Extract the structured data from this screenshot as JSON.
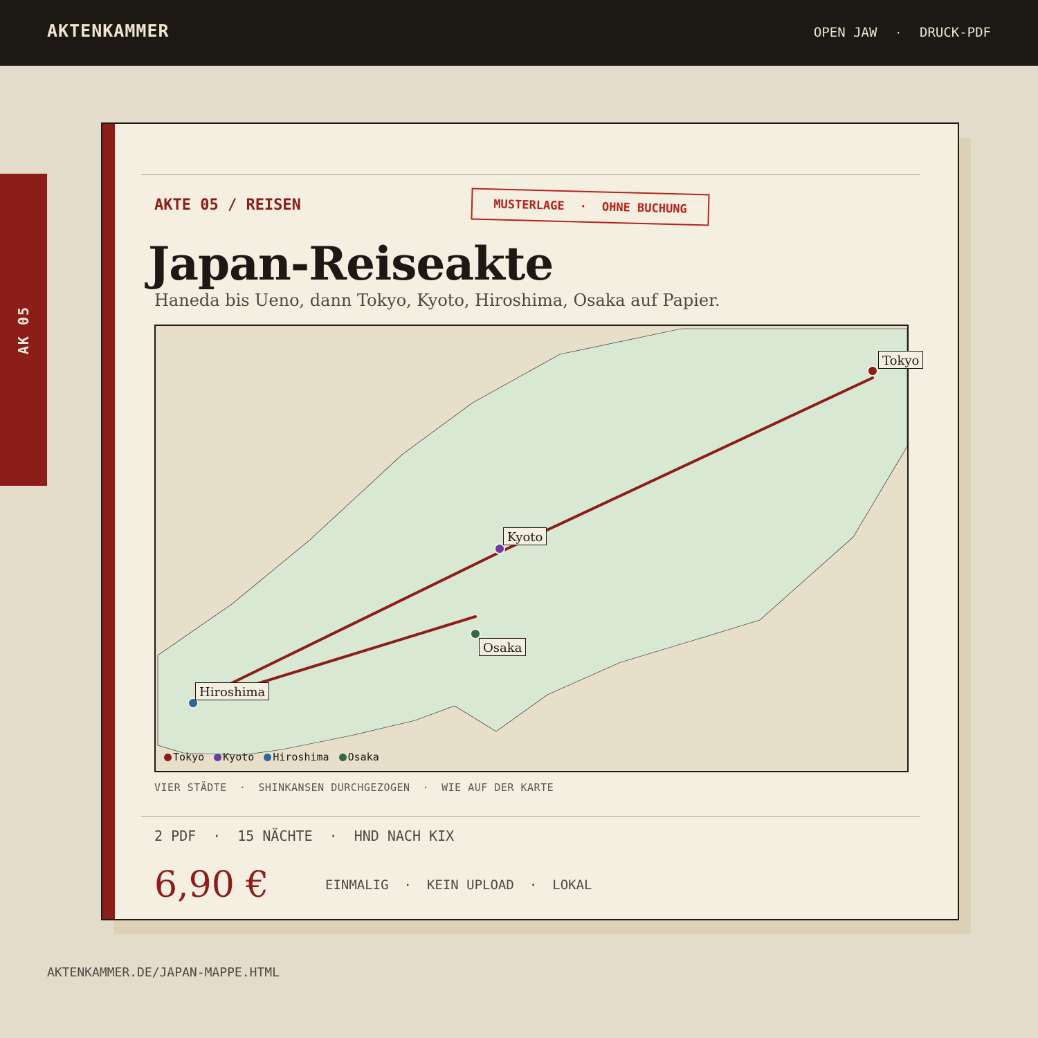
{
  "header": {
    "brand": "AKTENKAMMER",
    "nav": [
      "OPEN JAW",
      "DRUCK-PDF"
    ],
    "separator": "·"
  },
  "side_tab": {
    "label": "AK 05"
  },
  "card": {
    "kicker": "AKTE 05 / REISEN",
    "stamp": [
      "MUSTERLAGE",
      "OHNE BUCHUNG"
    ],
    "title": "Japan-Reiseakte",
    "subtitle": "Haneda bis Ueno, dann Tokyo, Kyoto, Hiroshima, Osaka auf Papier."
  },
  "map": {
    "cities": [
      {
        "name": "Tokyo",
        "color": "#8c1d18"
      },
      {
        "name": "Kyoto",
        "color": "#6a3fa0"
      },
      {
        "name": "Hiroshima",
        "color": "#2a6a9a"
      },
      {
        "name": "Osaka",
        "color": "#2f6b4a"
      }
    ],
    "route": [
      "Tokyo",
      "Kyoto",
      "Hiroshima",
      "Osaka"
    ],
    "land_color": "#d8e8d2",
    "sea_color": "#e8dfcb",
    "route_color": "#8c1d18",
    "caption": [
      "VIER STÄDTE",
      "SHINKANSEN DURCHGEZOGEN",
      "WIE AUF DER KARTE"
    ]
  },
  "facts": [
    "2 PDF",
    "15 NÄCHTE",
    "HND NACH KIX"
  ],
  "price": "6,90 €",
  "terms": [
    "EINMALIG",
    "KEIN UPLOAD",
    "LOKAL"
  ],
  "footer_url": "AKTENKAMMER.DE/JAPAN-MAPPE.HTML"
}
